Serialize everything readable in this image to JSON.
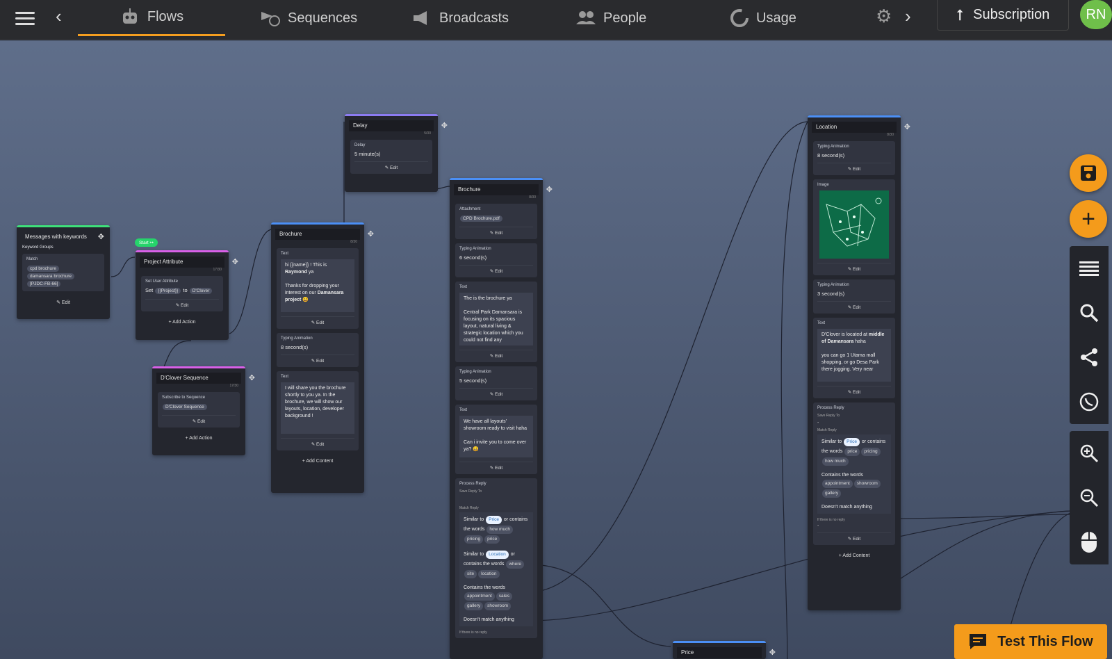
{
  "topbar": {
    "tabs": [
      {
        "label": "Flows",
        "icon": "bot-icon"
      },
      {
        "label": "Sequences",
        "icon": "sequence-icon"
      },
      {
        "label": "Broadcasts",
        "icon": "megaphone-icon"
      },
      {
        "label": "People",
        "icon": "people-icon"
      },
      {
        "label": "Usage",
        "icon": "usage-icon"
      }
    ],
    "subscription_label": "Subscription",
    "avatar_initials": "RN"
  },
  "start_badge": "Start",
  "nodes": {
    "keywords": {
      "title": "Messages with keywords",
      "group_label": "Keyword Groups",
      "match_label": "Match",
      "keywords": [
        "cpd brochure",
        "damansara brochure",
        "[PJDC-FB-66]"
      ],
      "edit": "Edit"
    },
    "project_attr": {
      "title": "Project Attribute",
      "counter": "17/30",
      "action_label": "Set User Attribute",
      "set": "Set",
      "attr": "{{Project}}",
      "to": "to",
      "value": "D'Clover",
      "edit": "Edit",
      "add_action": "Add Action"
    },
    "dclover_seq": {
      "title": "D'Clover Sequence",
      "counter": "17/30",
      "action_label": "Subscribe to Sequence",
      "value": "D'Clover Sequence",
      "edit": "Edit",
      "add_action": "Add Action"
    },
    "delay": {
      "title": "Delay",
      "counter": "5/30",
      "label": "Delay",
      "value": "5 minute(s)",
      "edit": "Edit"
    },
    "brochure1": {
      "title": "Brochure",
      "counter": "8/30",
      "text_label": "Text",
      "text1_a": "hi {{name}} ! This is",
      "text1_b": "Raymond",
      "text1_c": "ya",
      "text1_d": "Thanks for dropping your interest on our",
      "text1_e": "Damansara project",
      "typing_label": "Typing Animation",
      "typing_value": "8 second(s)",
      "text2": "I will share you the brochure shortly to you ya. In the brochure, we will show our layouts, location, developer background !",
      "edit": "Edit",
      "add_content": "Add Content"
    },
    "brochure2": {
      "title": "Brochure",
      "counter": "8/30",
      "attach_label": "Attachment",
      "attach_value": "CPD Brochure.pdf",
      "typing1_label": "Typing Animation",
      "typing1_value": "6 second(s)",
      "text_label": "Text",
      "text1": "The is the brochure ya",
      "text1b": "Central Park Damansara is focusing on its spacious layout, natural living & strategic location which you could not find any",
      "typing2_value": "5 second(s)",
      "text2": "We have all layouts' showroom ready to visit haha",
      "text2b": "Can i invite you to come over ya?",
      "process_label": "Process Reply",
      "save_reply": "Save Reply To",
      "match_reply": "Match Reply",
      "similar_to": "Similar to",
      "or": "or",
      "contains_words": "contains the words",
      "price_chip": "Price",
      "price_words": [
        "how much",
        "pricing",
        "price"
      ],
      "location_chip": "Location",
      "location_words": [
        "where",
        "site",
        "location"
      ],
      "contains_label": "Contains the words",
      "contains_words_list": [
        "appointment",
        "sales",
        "gallery",
        "showroom"
      ],
      "no_match": "Doesn't match anything",
      "no_reply": "If there is no reply",
      "edit": "Edit"
    },
    "location": {
      "title": "Location",
      "counter": "8/30",
      "typing1_label": "Typing Animation",
      "typing1_value": "8 second(s)",
      "image_label": "Image",
      "typing2_value": "3 second(s)",
      "text_label": "Text",
      "text_a": "D'Clover is located at",
      "text_b": "middle of Damansara",
      "text_c": "haha",
      "text_d": "you can go 1 Utama mall shopping, or go Desa Park there jogging. Very near",
      "process_label": "Process Reply",
      "save_reply": "Save Reply To",
      "dash": "-",
      "match_reply": "Match Reply",
      "similar_to": "Similar to",
      "or": "or",
      "contains_words": "contains the words",
      "price_chip": "Price",
      "price_words": [
        "price",
        "pricing",
        "how much"
      ],
      "contains_label": "Contains the words",
      "contains_words_list": [
        "appointment",
        "showroom",
        "gallery"
      ],
      "no_match": "Doesn't match anything",
      "no_reply": "If there is no reply",
      "edit": "Edit",
      "add_content": "Add Content"
    },
    "price": {
      "title": "Price"
    }
  },
  "test_flow_label": "Test This Flow",
  "colors": {
    "accent": "#f49b1b",
    "topbar": "#2a2b2e",
    "start_green": "#26d36b",
    "node_bg": "#24262e"
  }
}
